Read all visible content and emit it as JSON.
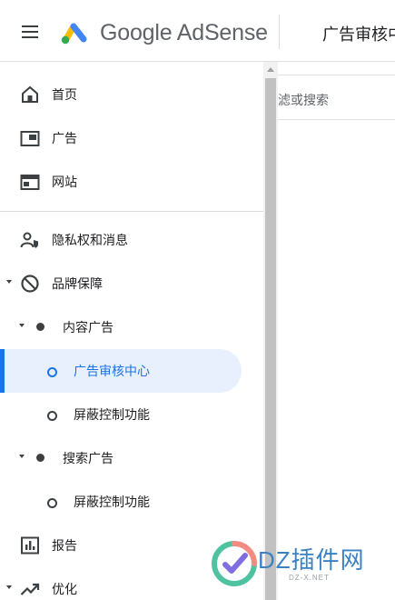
{
  "header": {
    "brand": "Google AdSense",
    "page_title": "广告审核中"
  },
  "sidebar": {
    "items": [
      {
        "label": "首页",
        "icon": "home-icon"
      },
      {
        "label": "广告",
        "icon": "ads-icon"
      },
      {
        "label": "网站",
        "icon": "sites-icon"
      },
      {
        "label": "隐私权和消息",
        "icon": "privacy-icon"
      },
      {
        "label": "品牌保障",
        "icon": "block-icon"
      },
      {
        "label": "内容广告"
      },
      {
        "label": "广告审核中心",
        "active": true
      },
      {
        "label": "屏蔽控制功能"
      },
      {
        "label": "搜索广告"
      },
      {
        "label": "屏蔽控制功能"
      },
      {
        "label": "报告",
        "icon": "reports-icon"
      },
      {
        "label": "优化",
        "icon": "trending-icon"
      }
    ]
  },
  "content": {
    "filter_placeholder": "滤或搜索"
  },
  "watermark": {
    "text": "DZ插件网",
    "url": "DZ-X.NET"
  },
  "colors": {
    "accent": "#1a73e8",
    "active_bg": "#e8f0fe"
  }
}
